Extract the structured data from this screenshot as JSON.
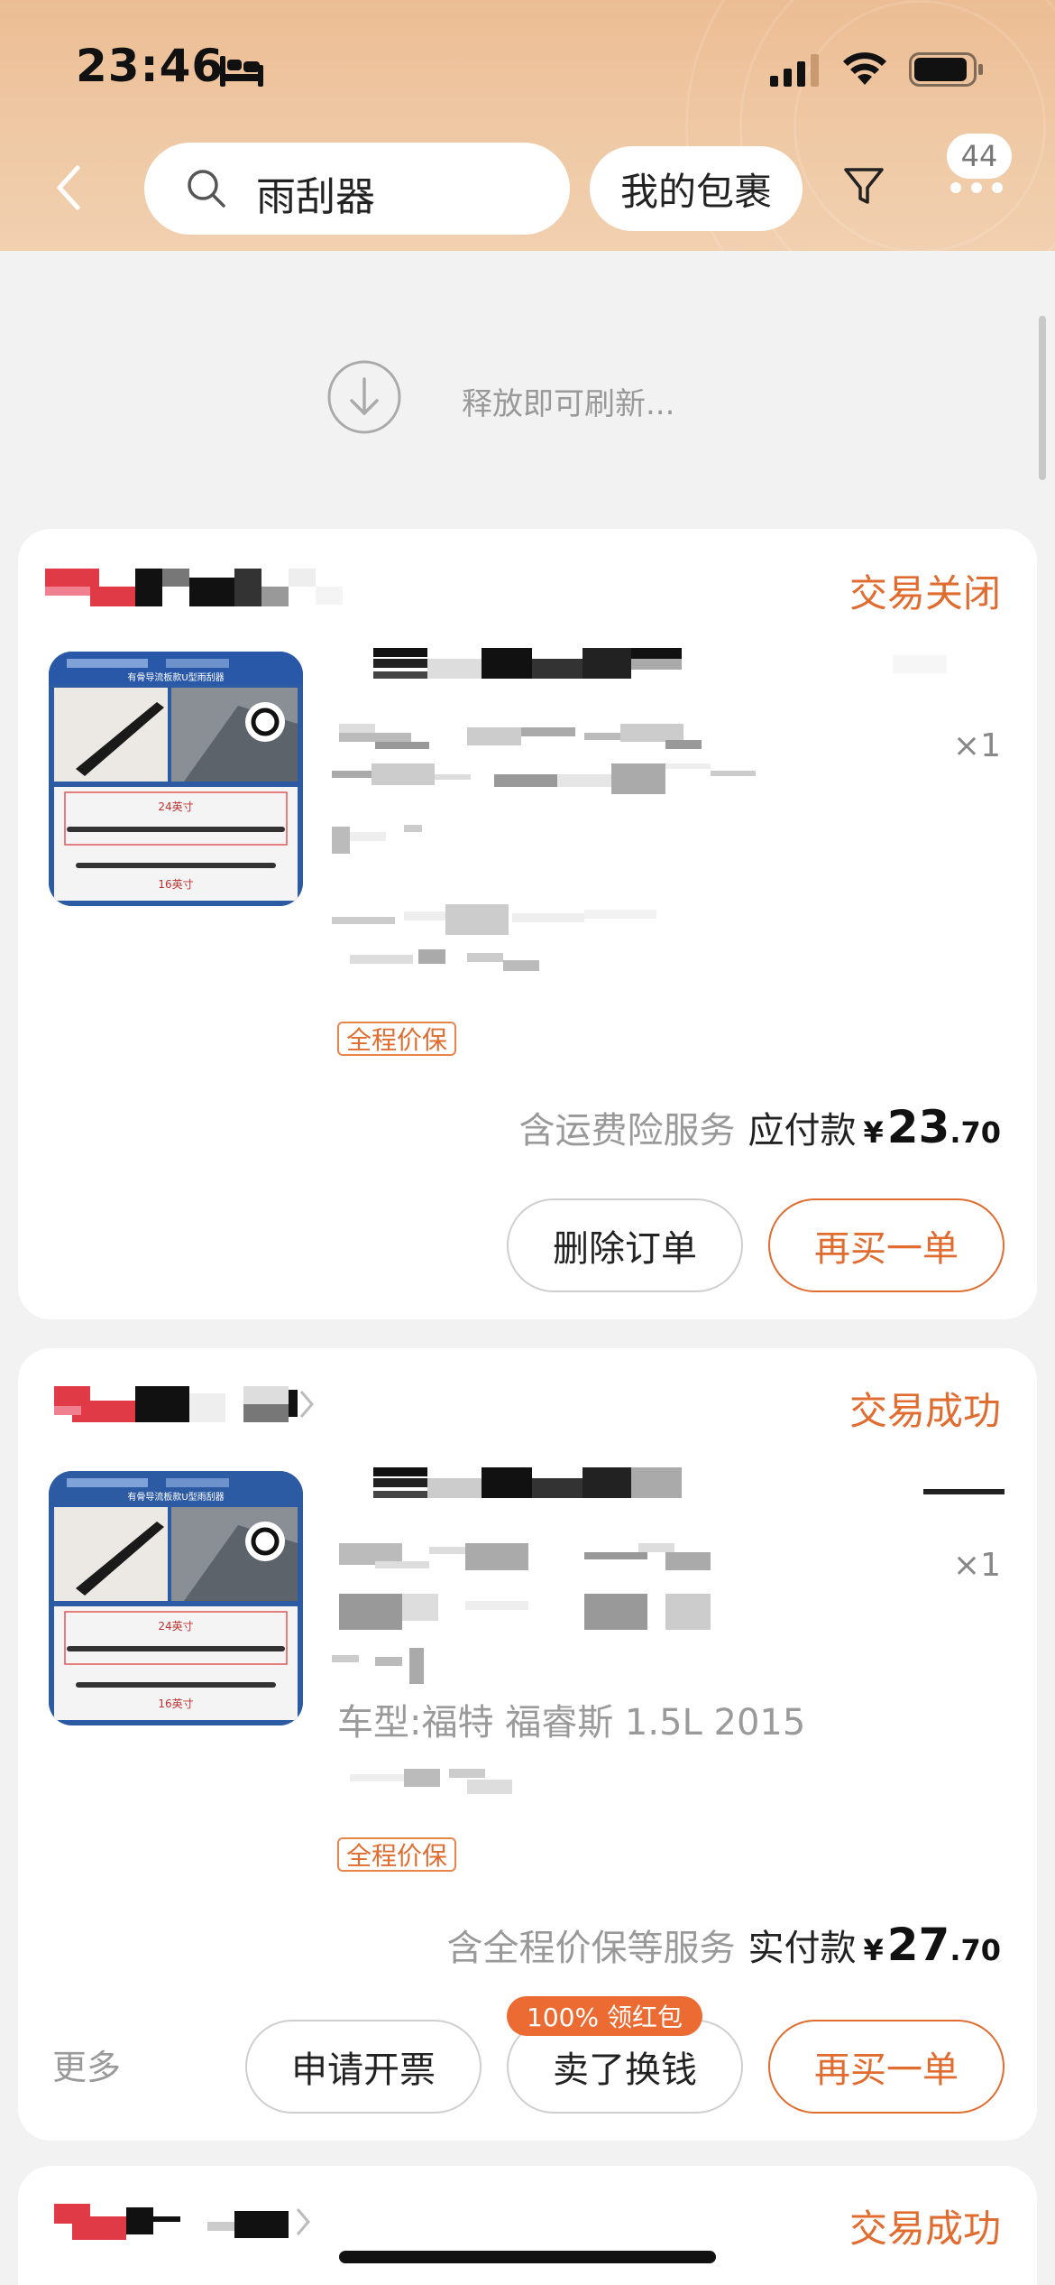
{
  "status_bar": {
    "time": "23:46"
  },
  "nav": {
    "search_value": "雨刮器",
    "parcel_button": "我的包裹",
    "more_badge": "44"
  },
  "refresh": {
    "text": "释放即可刷新..."
  },
  "orders": [
    {
      "status": "交易关闭",
      "quantity": "×1",
      "tag": "全程价保",
      "service_note": "含运费险服务",
      "price_label": "应付款",
      "currency": "¥",
      "price_int": "23",
      "price_dec": ".70",
      "buttons": [
        "删除订单",
        "再买一单"
      ]
    },
    {
      "status": "交易成功",
      "quantity": "×1",
      "car_model": "车型:福特 福睿斯 1.5L 2015",
      "tag": "全程价保",
      "service_note": "含全程价保等服务",
      "price_label": "实付款",
      "currency": "¥",
      "price_int": "27",
      "price_dec": ".70",
      "more": "更多",
      "promo_badge": "100% 领红包",
      "buttons": [
        "申请开票",
        "卖了换钱",
        "再买一单"
      ]
    },
    {
      "status": "交易成功"
    }
  ],
  "product_image": {
    "banner_text": "有骨导流板款U型雨刮器",
    "size_24": "24英寸",
    "size_16": "16英寸"
  },
  "colors": {
    "accent_orange": "#e06c2f",
    "header_bg": "#ecbd94",
    "page_bg": "#f2f2f2"
  }
}
